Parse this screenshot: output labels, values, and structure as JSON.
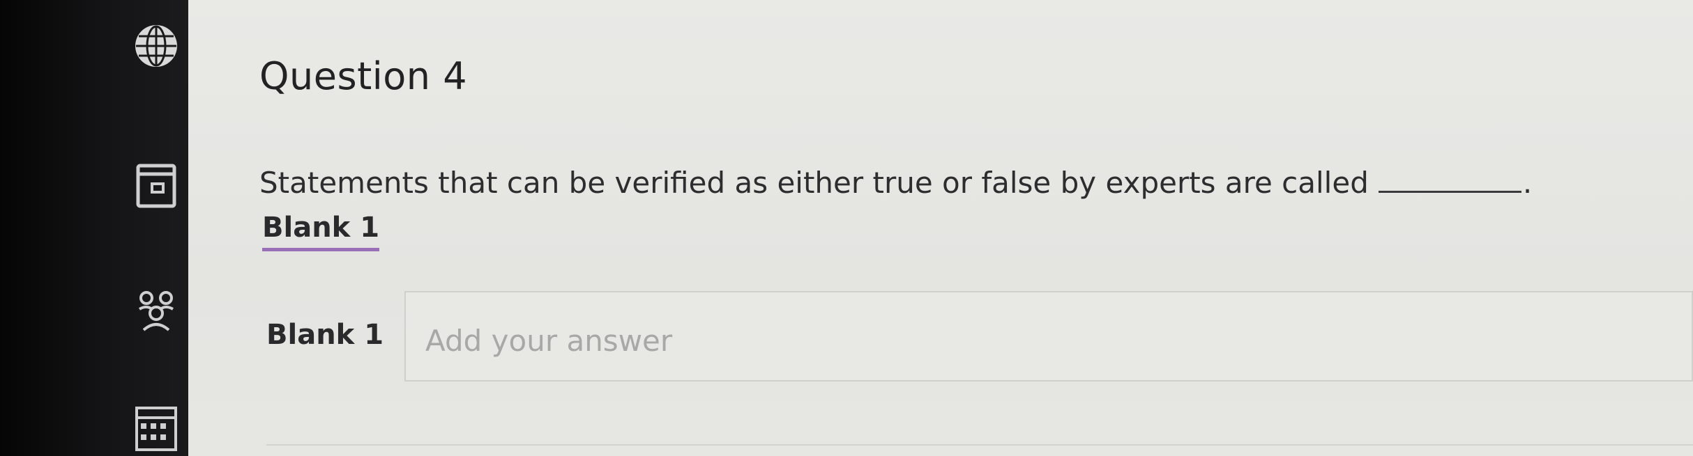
{
  "question": {
    "title": "Question 4",
    "prompt": "Statements that can be verified as either true or false by experts are called",
    "prompt_end": ".",
    "blank_link": "Blank 1"
  },
  "answer": {
    "label": "Blank 1",
    "placeholder": "Add your answer",
    "value": ""
  },
  "nav": {
    "icons": [
      "globe-icon",
      "calendar-icon",
      "people-icon",
      "grid-icon"
    ]
  },
  "colors": {
    "page_bg": "#e6e6e3",
    "text": "#2a2a2c",
    "blank_underline": "#9b6fb8",
    "bezel": "#141416"
  }
}
